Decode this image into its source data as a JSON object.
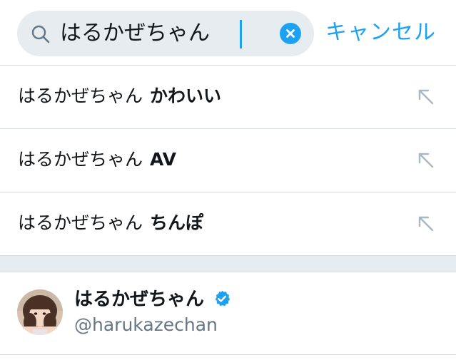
{
  "search": {
    "query": "はるかぜちゃん",
    "cancel_label": "キャンセル"
  },
  "suggestions": [
    {
      "prefix": "はるかぜちゃん",
      "suffix": "かわいい"
    },
    {
      "prefix": "はるかぜちゃん",
      "suffix": "AV"
    },
    {
      "prefix": "はるかぜちゃん",
      "suffix": "ちんぽ"
    }
  ],
  "user_result": {
    "display_name": "はるかぜちゃん",
    "handle": "@harukazechan",
    "verified": true
  },
  "colors": {
    "accent": "#1da1f2",
    "search_bg": "#e6ecf0",
    "divider": "#d6dbe0",
    "secondary_text": "#657786",
    "primary_text": "#14171a"
  },
  "icons": {
    "search": "magnifier-icon",
    "clear": "clear-x-icon",
    "fill": "arrow-up-left-icon",
    "verified": "verified-badge-icon"
  }
}
